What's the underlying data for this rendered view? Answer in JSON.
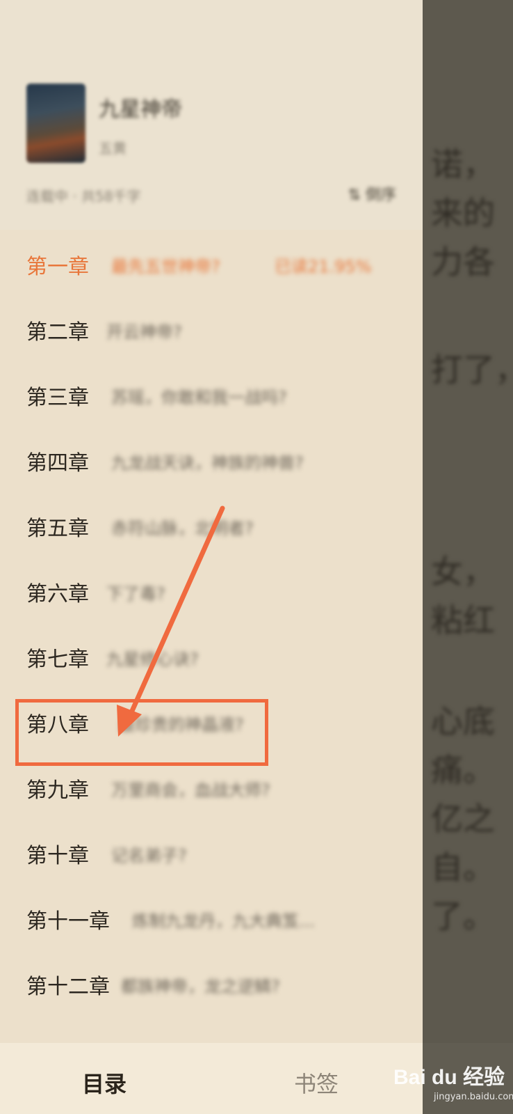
{
  "app": {
    "name": "reader-table-of-contents"
  },
  "book": {
    "title": "九星神帝",
    "author": "五黄",
    "status": "连载中 · 共58千字",
    "order_label": "⇅ 倒序"
  },
  "chapters": [
    {
      "number": "第一章",
      "title": "最先五世神帝?",
      "progress": "已读21.95%"
    },
    {
      "number": "第二章",
      "title": "开云神帝?"
    },
    {
      "number": "第三章",
      "title": "苏瑶，你敢和我一战吗?"
    },
    {
      "number": "第四章",
      "title": "九龙战天诀，神族的神兽?"
    },
    {
      "number": "第五章",
      "title": "赤符山脉，北明者?"
    },
    {
      "number": "第六章",
      "title": "下了毒?"
    },
    {
      "number": "第七章",
      "title": "九星修心诀?"
    },
    {
      "number": "第八章",
      "title": "最珍贵的神晶液?"
    },
    {
      "number": "第九章",
      "title": "万里商会，血战大师?"
    },
    {
      "number": "第十章",
      "title": "记名弟子?"
    },
    {
      "number": "第十一章",
      "title": "炼制九龙丹，九大典笈..."
    },
    {
      "number": "第十二章",
      "title": "都族神帝，龙之逆鳞?"
    }
  ],
  "tabs": {
    "toc_label": "目录",
    "bookmark_label": "书签"
  },
  "reader_text": [
    "诺，",
    "来的",
    "力各",
    "打了，",
    "女，",
    "粘红",
    "心底",
    "痛。",
    "亿之",
    "自。",
    "了。"
  ],
  "watermark": {
    "brand": "Bai du 经验",
    "url": "jingyan.baidu.com"
  },
  "colors": {
    "accent": "#e8763a",
    "annotation": "#f06a3f",
    "drawer_bg": "#ece0cb"
  },
  "annotation": {
    "highlighted_chapter": "第八章"
  }
}
